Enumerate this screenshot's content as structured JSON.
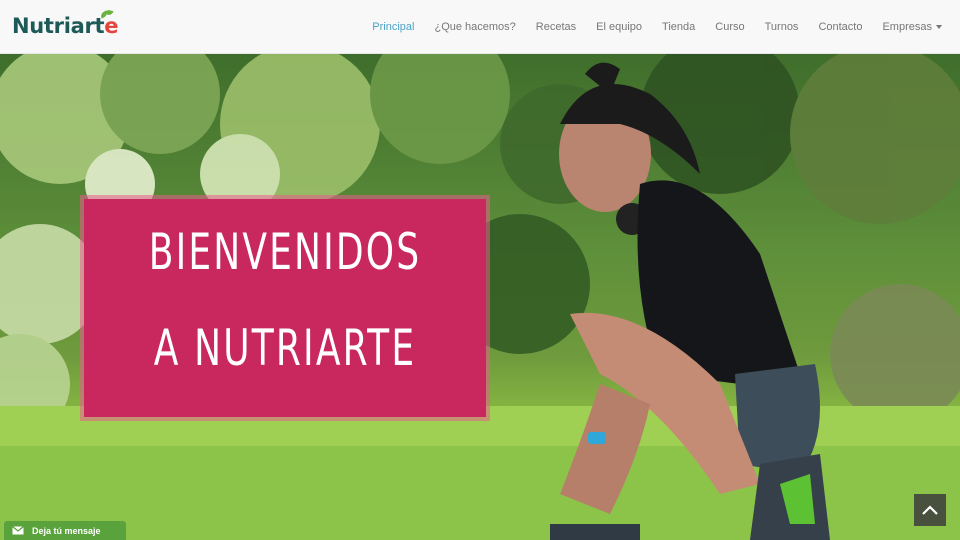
{
  "header": {
    "logo_text_main": "Nutriart",
    "logo_text_accent": "e",
    "nav_items": [
      {
        "label": "Principal",
        "active": true
      },
      {
        "label": "¿Que hacemos?"
      },
      {
        "label": "Recetas"
      },
      {
        "label": "El equipo"
      },
      {
        "label": "Tienda"
      },
      {
        "label": "Curso"
      },
      {
        "label": "Turnos"
      },
      {
        "label": "Contacto"
      },
      {
        "label": "Empresas",
        "dropdown": true
      }
    ]
  },
  "hero": {
    "banner_line1": "BIENVENIDOS",
    "banner_line2": "A NUTRIARTE",
    "image_icon": "woman-tying-shoe-photo"
  },
  "floating": {
    "message_label": "Deja tú mensaje",
    "message_icon": "envelope-icon",
    "scroll_icon": "chevron-up-icon"
  },
  "colors": {
    "brand_dark": "#1d5a57",
    "brand_accent": "#e4453f",
    "nav_active": "#4ba3c7",
    "banner": "#c9285f",
    "message_tab": "#5aa33c"
  }
}
